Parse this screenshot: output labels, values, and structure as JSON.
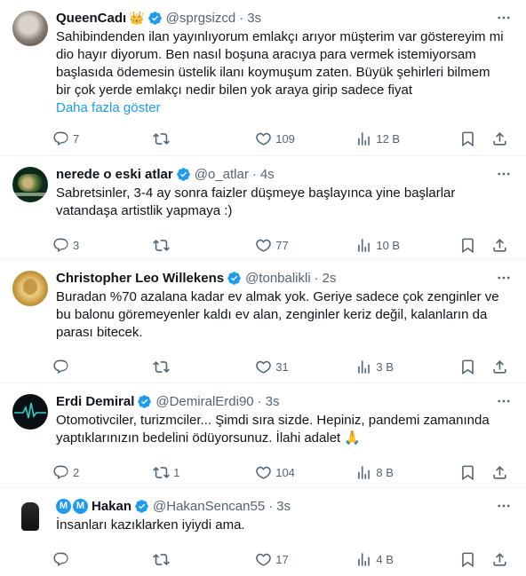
{
  "colors": {
    "accent": "#1d9bf0",
    "secondary_text": "#536471",
    "primary_text": "#0f1419"
  },
  "tweets": [
    {
      "name": "QueenCadı",
      "badge": "crown-emoji",
      "handle": "@sprgsizcd",
      "sep": "·",
      "time": "3s",
      "lines": [
        "Sahibindenden ilan yayınlıyorum emlakçı arıyor müşterim var göstereyim mi",
        "dio hayır diyorum. Ben nasıl boşuna aracıya para vermek istemiyorsam",
        "başlasıda ödemesin üstelik ilanı koymuşum zaten. Büyük şehirleri bilmem",
        "bir çok yerde emlakçı nedir bilen yok araya girip sadece fiyat"
      ],
      "show_more": "Daha fazla göster",
      "replies": "7",
      "retweets": "",
      "likes": "109",
      "views": "12 B"
    },
    {
      "name": "nerede o eski atlar",
      "handle": "@o_atlar",
      "sep": "·",
      "time": "4s",
      "lines": [
        "Sabretsinler, 3-4 ay sonra faizler düşmeye başlayınca yine başlarlar",
        "vatandaşa artistlik yapmaya :)"
      ],
      "replies": "3",
      "retweets": "",
      "likes": "77",
      "views": "10 B"
    },
    {
      "name": "Christopher Leo Willekens",
      "handle": "@tonbalikli",
      "sep": "·",
      "time": "2s",
      "lines": [
        "Buradan %70 azalana kadar ev almak yok. Geriye sadece çok zenginler ve",
        "bu balonu göremeyenler kaldı ev alan, zenginler keriz değil, kalanların da",
        "parası bitecek."
      ],
      "replies": "",
      "retweets": "",
      "likes": "31",
      "views": "3 B"
    },
    {
      "name": "Erdi Demiral",
      "handle": "@DemiralErdi90",
      "sep": "·",
      "time": "3s",
      "lines": [
        "Otomotivciler, turizmciler... Şimdi sıra sizde. Hepiniz, pandemi zamanında",
        "yaptıklarınızın bedelini ödüyorsunuz. İlahi adalet 🙏"
      ],
      "replies": "2",
      "retweets": "1",
      "likes": "104",
      "views": "8 B"
    },
    {
      "name": "Hakan",
      "name_prefix": "M",
      "handle": "@HakanSencan55",
      "sep": "·",
      "time": "3s",
      "lines": [
        "İnsanları kazıklarken iyiydi ama."
      ],
      "replies": "",
      "retweets": "",
      "likes": "17",
      "views": "4 B"
    }
  ]
}
